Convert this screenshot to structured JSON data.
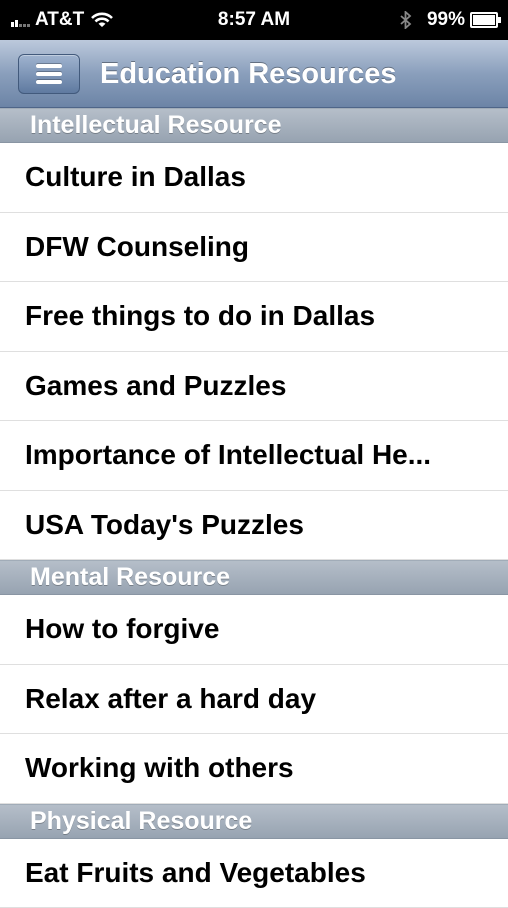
{
  "status_bar": {
    "carrier": "AT&T",
    "time": "8:57 AM",
    "battery_percent": "99%",
    "battery_level": 0.99,
    "signal_bars_on": 2,
    "signal_bars_total": 5
  },
  "navbar": {
    "title": "Education Resources",
    "menu_icon": "hamburger-menu-icon"
  },
  "sections": [
    {
      "title": "Intellectual Resource",
      "items": [
        "Culture in Dallas",
        "DFW Counseling",
        "Free things to do in Dallas",
        "Games and Puzzles",
        "Importance of Intellectual He...",
        "USA Today's Puzzles"
      ]
    },
    {
      "title": "Mental Resource",
      "items": [
        "How to forgive",
        "Relax after a hard day",
        "Working with others"
      ]
    },
    {
      "title": "Physical Resource",
      "items": [
        "Eat Fruits and Vegetables"
      ]
    }
  ],
  "colors": {
    "status_bar_bg": "#000000",
    "navbar_accent": "#7d93b3",
    "section_header_bg": "#a4afbd",
    "row_text": "#000000"
  }
}
